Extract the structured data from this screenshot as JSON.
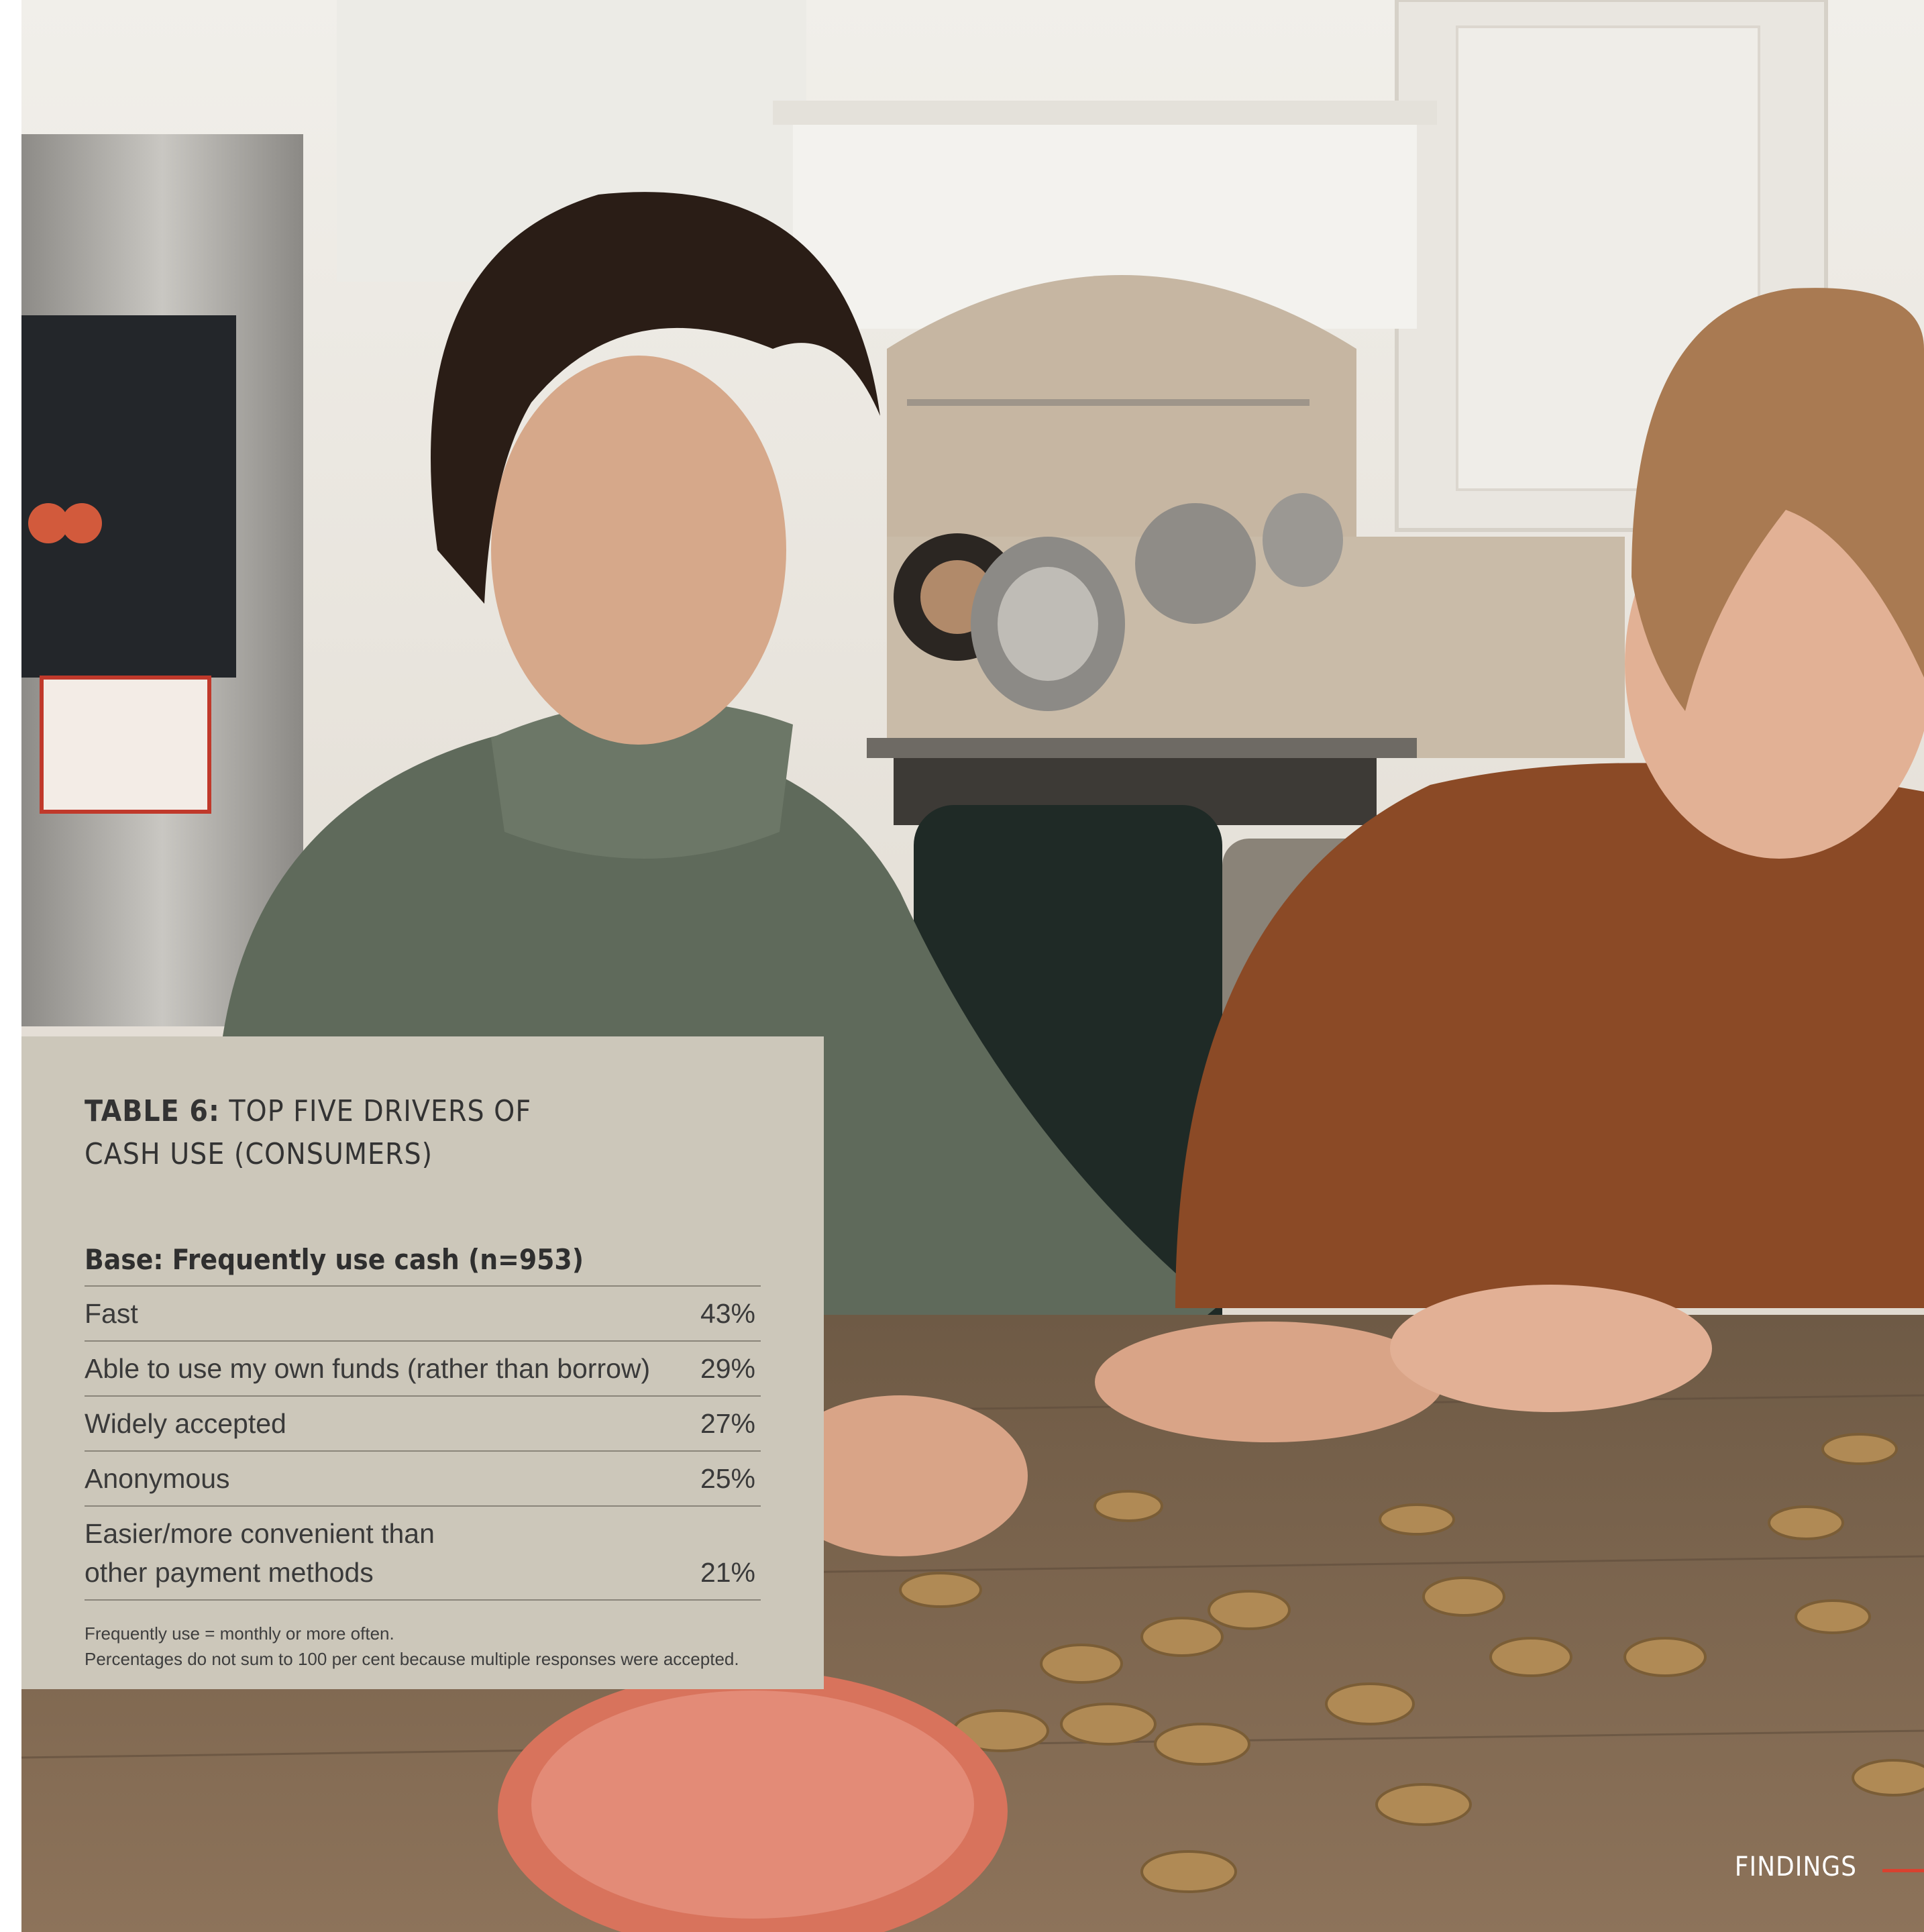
{
  "table": {
    "title_bold": "TABLE 6:",
    "title_rest": " TOP FIVE DRIVERS OF CASH USE (CONSUMERS)",
    "base": "Base: Frequently use cash (n=953)",
    "rows": [
      {
        "label": "Fast",
        "value": "43%"
      },
      {
        "label": "Able to use my own funds (rather than borrow)",
        "value": "29%"
      },
      {
        "label": "Widely accepted",
        "value": "27%"
      },
      {
        "label": "Anonymous",
        "value": "25%"
      },
      {
        "label": "Easier/more convenient than\nother payment methods",
        "value": "21%"
      }
    ],
    "note1": "Frequently use = monthly or more often.",
    "note2": "Percentages do not sum to 100 per cent because multiple responses were accepted."
  },
  "footer": {
    "section": "FINDINGS",
    "accent_color": "#d9412f"
  },
  "photo": {
    "subject": "two-boys-counting-coins-photo"
  }
}
